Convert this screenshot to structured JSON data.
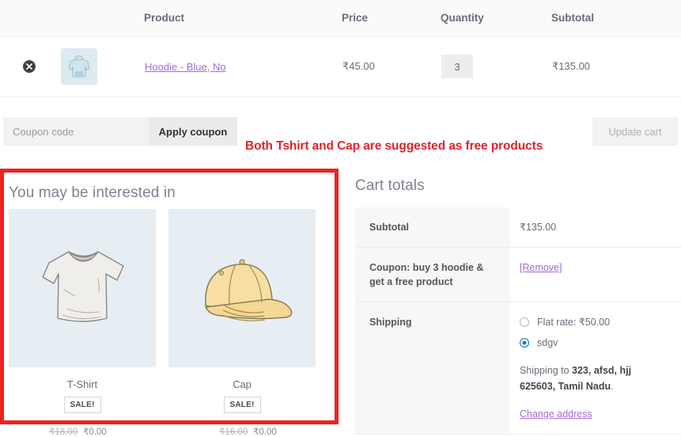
{
  "cart_table": {
    "headers": [
      "",
      "",
      "Product",
      "Price",
      "Quantity",
      "Subtotal"
    ],
    "rows": [
      {
        "remove_icon": "close-circle-icon",
        "thumb_icon": "hoodie-thumbnail",
        "product_name": "Hoodie - Blue, No",
        "price": "₹45.00",
        "quantity": "3",
        "subtotal": "₹135.00"
      }
    ]
  },
  "coupon": {
    "placeholder": "Coupon code",
    "value": "",
    "apply_label": "Apply coupon",
    "update_label": "Update cart"
  },
  "annotation": {
    "text": "Both Tshirt and Cap are suggested as free products",
    "color": "#e0232b"
  },
  "upsell": {
    "title": "You may be interested in",
    "highlight_color": "#ef2222",
    "products": [
      {
        "name": "T-Shirt",
        "badge": "SALE!",
        "old_price": "₹18.00",
        "new_price": "₹0.00",
        "image": "tshirt-illustration"
      },
      {
        "name": "Cap",
        "badge": "SALE!",
        "old_price": "₹16.00",
        "new_price": "₹0.00",
        "image": "cap-illustration"
      }
    ]
  },
  "cart_totals": {
    "title": "Cart totals",
    "subtotal_label": "Subtotal",
    "subtotal_value": "₹135.00",
    "coupon_label": "Coupon: buy 3 hoodie & get a free product",
    "coupon_action": "[Remove]",
    "shipping_label": "Shipping",
    "shipping_options": [
      {
        "label": "Flat rate: ₹50.00",
        "selected": false
      },
      {
        "label": "sdgv",
        "selected": true
      }
    ],
    "shipping_to_prefix": "Shipping to ",
    "shipping_to_address": "323, afsd, hjj 625603, Tamil Nadu",
    "shipping_to_suffix": ".",
    "change_address_label": "Change address"
  }
}
